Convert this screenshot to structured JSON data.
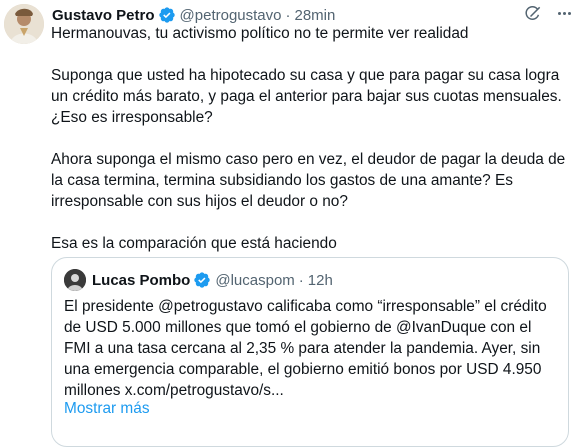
{
  "tweet": {
    "author_name": "Gustavo Petro",
    "author_handle": "@petrogustavo",
    "separator": "·",
    "time": "28min",
    "paragraphs": [
      "Hermanouvas, tu activismo político no te permite ver realidad",
      "Suponga que usted ha hipotecado su casa y que para pagar su casa logra un crédito más barato, y paga el anterior para bajar sus cuotas mensuales. ¿Eso es irresponsable?",
      "Ahora suponga el mismo caso pero en vez, el deudor de pagar la deuda de la casa termina, termina subsidiando los gastos de una amante? Es irresponsable con sus hijos el deudor o no?",
      "Esa es la comparación que está haciendo"
    ]
  },
  "quoted_tweet": {
    "author_name": "Lucas Pombo",
    "author_handle": "@lucaspom",
    "separator": "·",
    "time": "12h",
    "text": "El presidente @petrogustavo calificaba como “irresponsable” el crédito de USD 5.000 millones que tomó el gobierno de @IvanDuque con el FMI a una tasa cercana al 2,35 % para atender la pandemia. Ayer, sin una emergencia comparable, el gobierno emitió bonos por USD 4.950 millones x.com/petrogustavo/s...",
    "show_more": "Mostrar más"
  },
  "icons": {
    "verified": "verified-badge-icon",
    "grok": "grok-icon",
    "more": "more-options-icon"
  },
  "colors": {
    "verified_blue": "#1d9bf0",
    "link_blue": "#1d9bf0",
    "secondary_text": "#536471",
    "border": "#cfd9de"
  }
}
